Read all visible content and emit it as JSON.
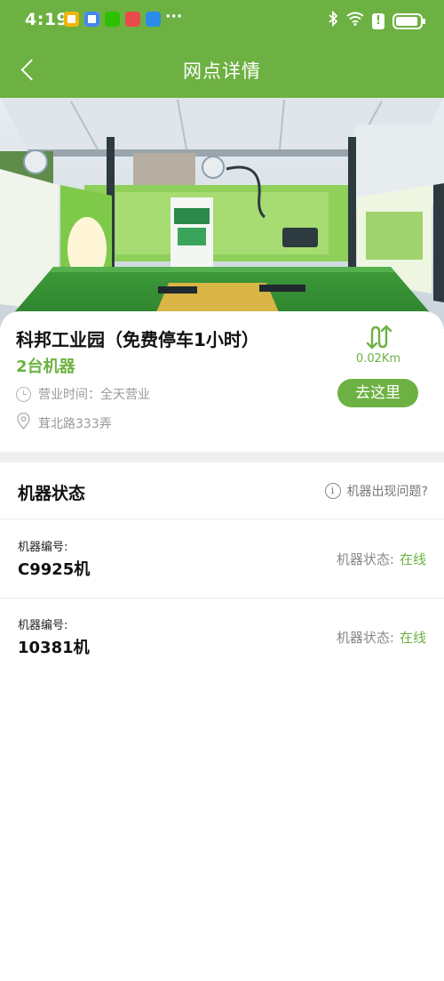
{
  "status_bar": {
    "time": "4:19",
    "more": "···",
    "alert_glyph": "!",
    "icons": [
      "bluetooth-icon",
      "wifi-icon",
      "alert-icon",
      "battery-icon"
    ]
  },
  "nav": {
    "title": "网点详情"
  },
  "station": {
    "name": "科邦工业园（免费停车1小时）",
    "machine_count": "2台机器",
    "hours": "营业时间：全天营业",
    "address": "茸北路333弄",
    "distance": "0.02Km",
    "go_label": "去这里"
  },
  "machine_status": {
    "title": "机器状态",
    "issue_link": "机器出现问题?",
    "info_glyph": "i",
    "machines": [
      {
        "label": "机器编号:",
        "id": "C9925机",
        "status_label": "机器状态:",
        "status_value": "在线"
      },
      {
        "label": "机器编号:",
        "id": "10381机",
        "status_label": "机器状态:",
        "status_value": "在线"
      }
    ]
  },
  "colors": {
    "brand_green": "#6db142",
    "muted_text": "#999999",
    "divider": "#efefef"
  }
}
